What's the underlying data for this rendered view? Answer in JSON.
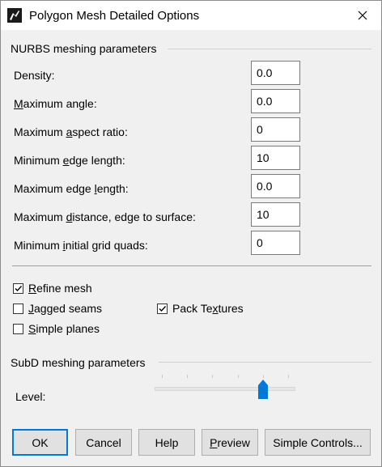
{
  "window": {
    "title": "Polygon Mesh Detailed Options"
  },
  "nurbs": {
    "heading": "NURBS meshing parameters",
    "fields": [
      {
        "label_pre": "Density:",
        "mnemonic": "",
        "label_post": "",
        "value": "0.0"
      },
      {
        "label_pre": "",
        "mnemonic": "M",
        "label_post": "aximum angle:",
        "value": "0.0"
      },
      {
        "label_pre": "Maximum ",
        "mnemonic": "a",
        "label_post": "spect ratio:",
        "value": "0"
      },
      {
        "label_pre": "Minimum ",
        "mnemonic": "e",
        "label_post": "dge length:",
        "value": "10"
      },
      {
        "label_pre": "Maximum edge ",
        "mnemonic": "l",
        "label_post": "ength:",
        "value": "0.0"
      },
      {
        "label_pre": "Maximum ",
        "mnemonic": "d",
        "label_post": "istance, edge to surface:",
        "value": "10"
      },
      {
        "label_pre": "Minimum ",
        "mnemonic": "i",
        "label_post": "nitial grid quads:",
        "value": "0"
      }
    ]
  },
  "options": {
    "refine_mesh": {
      "mnemonic": "R",
      "rest": "efine mesh",
      "checked": true
    },
    "jagged_seams": {
      "mnemonic": "J",
      "rest": "agged seams",
      "checked": false
    },
    "simple_planes": {
      "mnemonic": "S",
      "rest": "imple planes",
      "checked": false
    },
    "pack_textures": {
      "pre": "Pack Te",
      "mnemonic": "x",
      "rest": "tures",
      "checked": true
    }
  },
  "subd": {
    "heading": "SubD meshing parameters",
    "level_label": "Level:",
    "level": 4,
    "level_max": 5
  },
  "buttons": {
    "ok": "OK",
    "cancel": "Cancel",
    "help": "Help",
    "preview_mnemonic": "P",
    "preview_rest": "review",
    "simple_controls": "Simple Controls..."
  },
  "colors": {
    "accent": "#0078d7",
    "window_bg": "#f0f0f0"
  }
}
